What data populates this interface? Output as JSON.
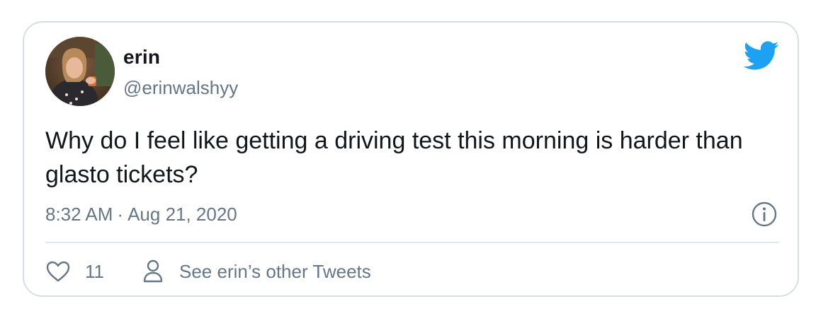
{
  "tweet": {
    "author_name": "erin",
    "author_handle": "@erinwalshyy",
    "text": "Why do I feel like getting a driving test this morning is harder than glasto tickets?",
    "time": "8:32 AM",
    "date": "Aug 21, 2020",
    "separator": "·",
    "like_count": "11",
    "see_other_label": "See erin’s other Tweets"
  },
  "icons": {
    "brand": "twitter-bird-icon",
    "info": "info-icon",
    "like": "heart-icon",
    "profile": "person-icon"
  },
  "colors": {
    "brand": "#1da1f2",
    "text_primary": "#14171a",
    "text_secondary": "#657786",
    "border": "#d7dfe6"
  }
}
